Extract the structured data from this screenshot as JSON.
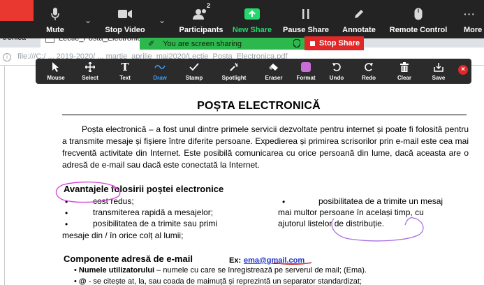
{
  "zoom_toolbar": {
    "items": [
      {
        "label": "Mute",
        "icon": "microphone-icon"
      },
      {
        "label": "Stop Video",
        "icon": "video-camera-icon"
      },
      {
        "label": "Participants",
        "icon": "participants-icon",
        "count": "2"
      },
      {
        "label": "New Share",
        "icon": "share-screen-icon"
      },
      {
        "label": "Pause Share",
        "icon": "pause-icon"
      },
      {
        "label": "Annotate",
        "icon": "pencil-icon"
      },
      {
        "label": "Remote Control",
        "icon": "mouse-icon"
      },
      {
        "label": "More",
        "icon": "more-icon"
      }
    ],
    "accent_green": "#23d96c"
  },
  "browser": {
    "left_tab_text": "tronica",
    "active_tab_title": "Lectie_Posta_Electronica",
    "address": "file:///C:/ ... 2019-2020/ ... martie_aprilie_mai2020/Lectie_Posta_Electronica.pdf"
  },
  "share_banner": {
    "text": "You are screen sharing",
    "stop_label": "Stop Share",
    "banner_color": "#2db84d",
    "stop_color": "#e02828"
  },
  "annotate_toolbar": {
    "tools": [
      {
        "label": "Mouse",
        "icon": "cursor-icon"
      },
      {
        "label": "Select",
        "icon": "move-icon"
      },
      {
        "label": "Text",
        "icon": "text-icon"
      },
      {
        "label": "Draw",
        "icon": "draw-wave-icon"
      },
      {
        "label": "Stamp",
        "icon": "checkmark-icon"
      },
      {
        "label": "Spotlight",
        "icon": "spotlight-icon"
      },
      {
        "label": "Eraser",
        "icon": "eraser-icon"
      },
      {
        "label": "Format",
        "icon": "format-swatch-icon"
      },
      {
        "label": "Undo",
        "icon": "undo-icon"
      },
      {
        "label": "Redo",
        "icon": "redo-icon"
      },
      {
        "label": "Clear",
        "icon": "trash-icon"
      },
      {
        "label": "Save",
        "icon": "save-icon"
      }
    ],
    "active_tool": "Draw",
    "format_color": "#c86dd7"
  },
  "document": {
    "title": "POȘTA ELECTRONICĂ",
    "intro": "Poșta electronică – a fost unul dintre primele servicii dezvoltate pentru internet și poate fi folosită pentru a transmite mesaje și fișiere între diferite persoane.  Expedierea și primirea scrisorilor prin e-mail este cea mai frecventă activitate din Internet. Este posibilă comunicarea cu orice persoană din lume, dacă aceasta are o adresă de e-mail sau dacă este conectată la Internet.",
    "advantages_heading": "Avantajele folosirii poștei electronice",
    "advantages_left": [
      "cost redus;",
      "transmiterea rapidă a mesajelor;",
      "posibilitatea de a trimite sau primi"
    ],
    "advantages_left_cont": "mesaje din / în orice colț al lumii;",
    "advantages_right_first": "posibilitatea de a trimite un mesaj",
    "advantages_right_cont": [
      "mai multor persoane în același timp, cu",
      "ajutorul listelor de distribuție."
    ],
    "components_heading": "Componente adresă de e-mail",
    "example_label": "Ex:",
    "example_email": "ema@gmail.com",
    "components": [
      {
        "term": "Numele utilizatorului",
        "desc": " – numele cu care se înregistrează pe serverul de mail; (Ema)."
      },
      {
        "term": "@",
        "desc": " - se citește at, la, sau coada de maimuță și reprezintă un separator standardizat;"
      }
    ],
    "annotation_color": "#d63fd6"
  }
}
